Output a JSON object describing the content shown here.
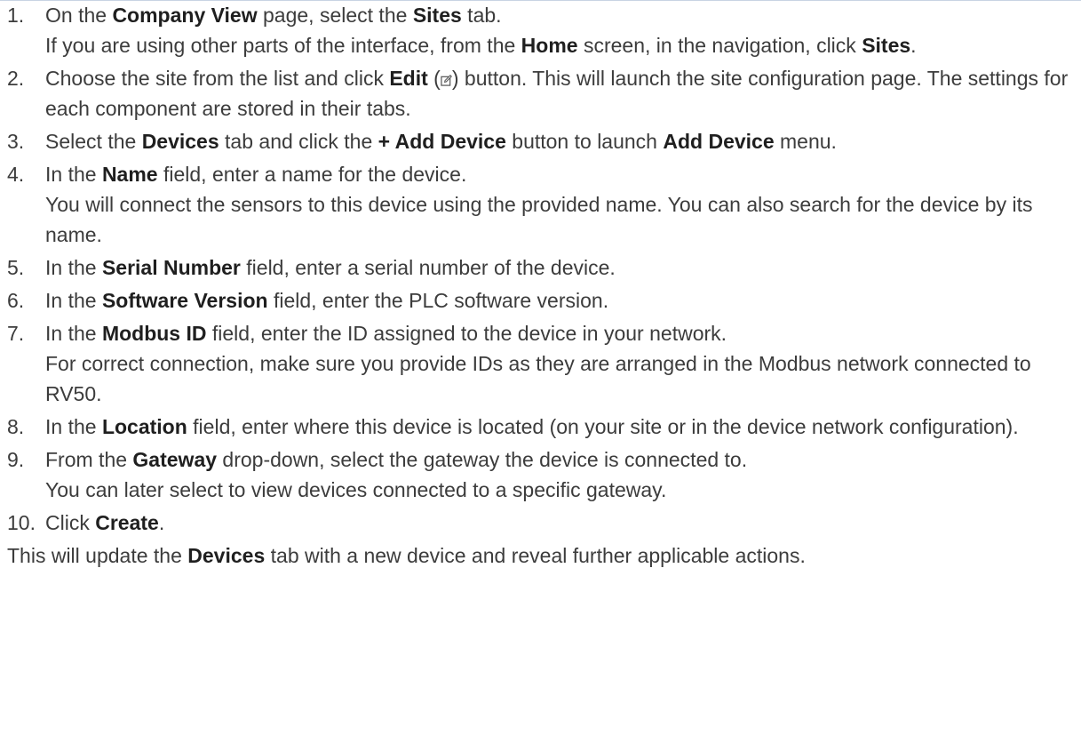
{
  "steps": [
    {
      "num": "1.",
      "t1": "On the ",
      "b1": "Company View",
      "t2": " page, select the ",
      "b2": "Sites",
      "t3": " tab.",
      "s1": "If you are using other parts of the interface, from the ",
      "s2": "Home",
      "s3": " screen, in the navigation, click ",
      "s4": "Sites",
      "s5": "."
    },
    {
      "num": "2.",
      "t1": "Choose the site from the list and click ",
      "b1": "Edit",
      "t2": " (",
      "t3": ") button. This will launch the site configuration page. The settings for each component are stored in their tabs."
    },
    {
      "num": "3.",
      "t1": "Select the ",
      "b1": "Devices",
      "t2": " tab and click the ",
      "b2": "+ Add Device",
      "t3": " button to launch ",
      "b3": "Add Device",
      "t4": " menu."
    },
    {
      "num": "4.",
      "t1": "In the ",
      "b1": "Name",
      "t2": " field, enter a name for the device.",
      "s1": "You will connect the sensors to this device using the provided name. You can also search for the device by its name."
    },
    {
      "num": "5.",
      "t1": "In the ",
      "b1": "Serial Number",
      "t2": " field, enter a serial number of the device."
    },
    {
      "num": "6.",
      "t1": "In the ",
      "b1": "Software Version",
      "t2": " field, enter the PLC software version."
    },
    {
      "num": "7.",
      "t1": "In the ",
      "b1": "Modbus ID",
      "t2": " field, enter the ID assigned to the device in your network.",
      "s1": "For correct connection, make sure you provide IDs as they are arranged in the Modbus network connected to RV50."
    },
    {
      "num": "8.",
      "t1": "In the ",
      "b1": "Location",
      "t2": " field, enter where this device is located (on your site or in the device network configuration)."
    },
    {
      "num": "9.",
      "t1": "From the ",
      "b1": "Gateway",
      "t2": " drop-down, select the gateway the device is connected to.",
      "s1": "You can later select to view devices connected to a specific gateway."
    },
    {
      "num": "10.",
      "t1": "Click ",
      "b1": "Create",
      "t2": "."
    }
  ],
  "outro": {
    "t1": "This will update the ",
    "b1": "Devices",
    "t2": " tab with a new device and reveal further applicable actions."
  },
  "icons": {
    "edit": "edit-icon"
  },
  "colors": {
    "text": "#3c3c3c",
    "bold": "#1f1f1f",
    "rule": "#c8d3e3"
  }
}
